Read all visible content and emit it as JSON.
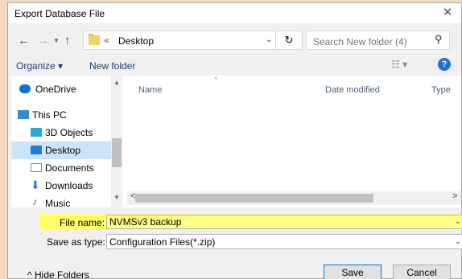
{
  "window": {
    "title": "Export Database File",
    "close_label": "✕"
  },
  "address_bar": {
    "path": "Desktop",
    "separator": "«",
    "search_placeholder": "Search New folder (4)"
  },
  "toolbar": {
    "organize_label": "Organize ▾",
    "new_folder_label": "New folder",
    "help_label": "?"
  },
  "nav_pane": {
    "items": [
      {
        "label": "OneDrive",
        "icon": "cloud-icon",
        "color": "#0a74d6"
      },
      {
        "label": "This PC",
        "icon": "computer-icon",
        "color": "#2f8ccf"
      },
      {
        "label": "3D Objects",
        "icon": "cube-icon",
        "color": "#2aa9d8"
      },
      {
        "label": "Desktop",
        "icon": "desktop-icon",
        "color": "#1e7fd1",
        "selected": true
      },
      {
        "label": "Documents",
        "icon": "document-icon",
        "color": "#7a8aa3"
      },
      {
        "label": "Downloads",
        "icon": "download-icon",
        "color": "#2a78d4"
      },
      {
        "label": "Music",
        "icon": "music-icon",
        "color": "#2a78d4"
      }
    ]
  },
  "file_list": {
    "columns": [
      "Name",
      "Date modified",
      "Type"
    ],
    "rows": []
  },
  "filename": {
    "label": "File name:",
    "value": "NVMSv3 backup"
  },
  "save_as_type": {
    "label": "Save as type:",
    "value": "Configuration Files(*.zip)"
  },
  "footer": {
    "hide_folders_label": "Hide Folders",
    "save_label": "Save",
    "cancel_label": "Cancel"
  },
  "colors": {
    "highlight": "#ffff66",
    "selection": "#cce4f7",
    "accent": "#0078d7"
  }
}
